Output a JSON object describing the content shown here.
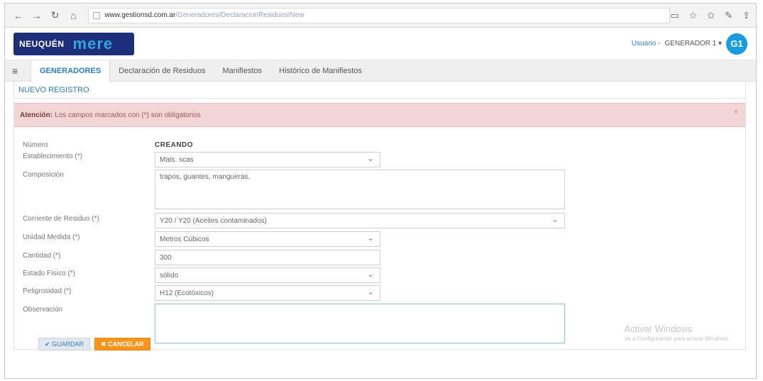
{
  "browser": {
    "url_host": "www.gestionsd.com.ar",
    "url_path": "/Generadores/DeclaracionResiduos/New"
  },
  "header": {
    "logo_main": "NEUQUÉN",
    "logo_sub": "mere",
    "user_label": "Usuario -",
    "user_name": "GENERADOR 1 ▾",
    "avatar": "G1"
  },
  "nav": {
    "items": [
      {
        "label": "GENERADORES"
      },
      {
        "label": "Declaración de Residuos"
      },
      {
        "label": "Manifiestos"
      },
      {
        "label": "Histórico de Manifiestos"
      }
    ]
  },
  "panel": {
    "title": "NUEVO REGISTRO",
    "alert_strong": "Atención:",
    "alert_text": "Los campos marcados con (*) son obligatorios",
    "alert_close": "×"
  },
  "form": {
    "numero": {
      "label": "Número",
      "value": "CREANDO"
    },
    "establecimiento": {
      "label": "Establecimiento (*)",
      "value": "Mats. scas"
    },
    "composicion": {
      "label": "Composición",
      "value": "trapos, guantes, mangueras."
    },
    "corriente": {
      "label": "Corriente de Residuo (*)",
      "value": "Y20 / Y20 (Aceites contaminados)"
    },
    "unidad": {
      "label": "Unidad Medida (*)",
      "value": "Metros Cúbicos"
    },
    "cantidad": {
      "label": "Cantidad (*)",
      "value": "300"
    },
    "estado": {
      "label": "Estado Físico (*)",
      "value": "sólido"
    },
    "peligrosidad": {
      "label": "Peligrosidad (*)",
      "value": "H12 (Ecotóxicos)"
    },
    "observacion": {
      "label": "Observación",
      "value": ""
    }
  },
  "buttons": {
    "save": "✔ GUARDAR",
    "cancel": "✖ CANCELAR"
  },
  "watermark": {
    "line1": "Activar Windows",
    "line2": "Ve a Configuración para activar Windows."
  }
}
